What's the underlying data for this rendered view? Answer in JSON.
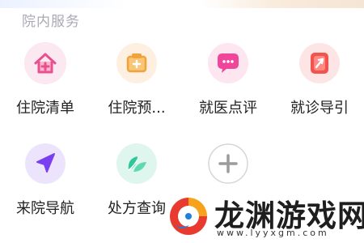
{
  "section": {
    "title": "院内服务"
  },
  "services": [
    {
      "label": "住院清单",
      "icon": "house-plus-icon"
    },
    {
      "label": "住院预...",
      "icon": "clipboard-box-icon"
    },
    {
      "label": "就医点评",
      "icon": "chat-bubble-icon"
    },
    {
      "label": "就诊导引",
      "icon": "guide-pointer-icon"
    },
    {
      "label": "来院导航",
      "icon": "navigation-arrow-icon"
    },
    {
      "label": "处方查询",
      "icon": "leaf-icon"
    },
    {
      "label": "",
      "icon": "plus-icon"
    }
  ],
  "watermark": {
    "title": "龙渊游戏网",
    "url": "www.lyyxgm.com"
  },
  "colors": {
    "title_gray": "#a9a9b3",
    "label_dark": "#222222",
    "house_pink": "#e8508f",
    "clipboard_orange": "#f2a23a",
    "chat_pink": "#f0459b",
    "guide_red": "#f2544d",
    "nav_purple": "#7a3ff0",
    "leaf_green": "#2fc79a",
    "plus_gray": "#9c9c9c"
  }
}
